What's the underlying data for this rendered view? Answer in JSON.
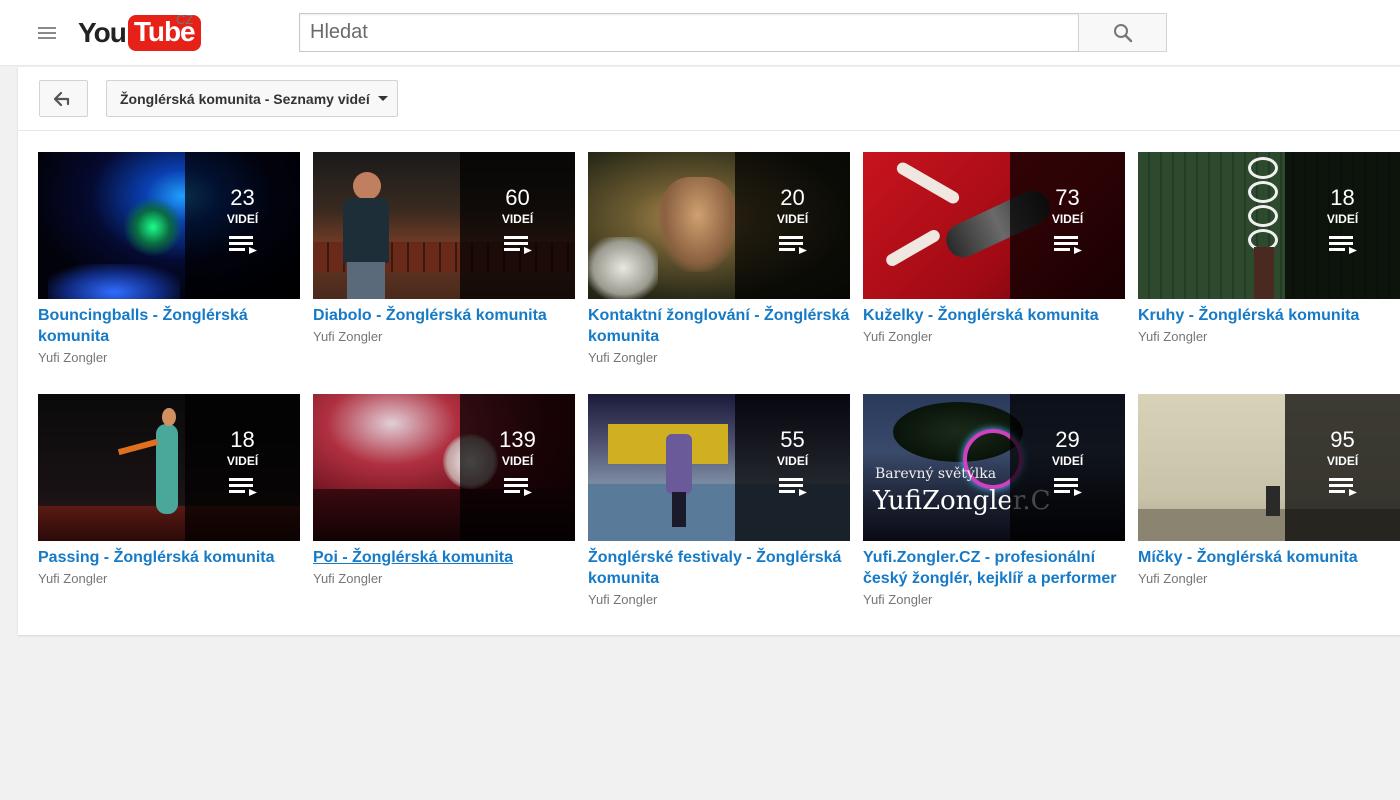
{
  "masthead": {
    "logo_you": "You",
    "logo_tube": "Tube",
    "logo_country": "CZ",
    "search_placeholder": "Hledat"
  },
  "toolbar": {
    "playlist_selector_label": "Žonglérská komunita - Seznamy videí"
  },
  "accent_color": "#167ac6",
  "brand_color": "#e62117",
  "playlists": [
    {
      "title": "Bouncingballs - Žonglérská komunita",
      "owner": "Yufi Zongler",
      "count": "23",
      "unit": "VIDEÍ"
    },
    {
      "title": "Diabolo - Žonglérská komunita",
      "owner": "Yufi Zongler",
      "count": "60",
      "unit": "VIDEÍ"
    },
    {
      "title": "Kontaktní žonglování - Žonglérská komunita",
      "owner": "Yufi Zongler",
      "count": "20",
      "unit": "VIDEÍ"
    },
    {
      "title": "Kuželky - Žonglérská komunita",
      "owner": "Yufi Zongler",
      "count": "73",
      "unit": "VIDEÍ"
    },
    {
      "title": "Kruhy - Žonglérská komunita",
      "owner": "Yufi Zongler",
      "count": "18",
      "unit": "VIDEÍ"
    },
    {
      "title": "Passing - Žonglérská komunita",
      "owner": "Yufi Zongler",
      "count": "18",
      "unit": "VIDEÍ"
    },
    {
      "title": "Poi - Žonglérská komunita",
      "owner": "Yufi Zongler",
      "count": "139",
      "unit": "VIDEÍ"
    },
    {
      "title": "Žonglérské festivaly - Žonglérská komunita",
      "owner": "Yufi Zongler",
      "count": "55",
      "unit": "VIDEÍ"
    },
    {
      "title": "Yufi.Zongler.CZ - profesionální český žonglér, kejklíř a performer",
      "owner": "Yufi Zongler",
      "count": "29",
      "unit": "VIDEÍ",
      "thumb_caption": "Barevný světýlka",
      "thumb_logo": "YufiZongler.C"
    },
    {
      "title": "Míčky - Žonglérská komunita",
      "owner": "Yufi Zongler",
      "count": "95",
      "unit": "VIDEÍ"
    }
  ]
}
